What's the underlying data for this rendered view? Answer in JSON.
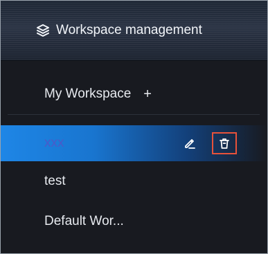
{
  "header": {
    "title": "Workspace management",
    "icon": "layers-icon"
  },
  "section": {
    "title": "My Workspace",
    "add_label": "+"
  },
  "workspaces": [
    {
      "label": "xxx",
      "active": true
    },
    {
      "label": "test",
      "active": false
    },
    {
      "label": "Default Wor...",
      "active": false
    }
  ],
  "icons": {
    "edit": "edit-icon",
    "delete": "trash-icon"
  },
  "colors": {
    "background": "#181a20",
    "accent": "#1e86e6",
    "active_text": "#4b5ac9",
    "highlight_border": "#e8523a"
  }
}
